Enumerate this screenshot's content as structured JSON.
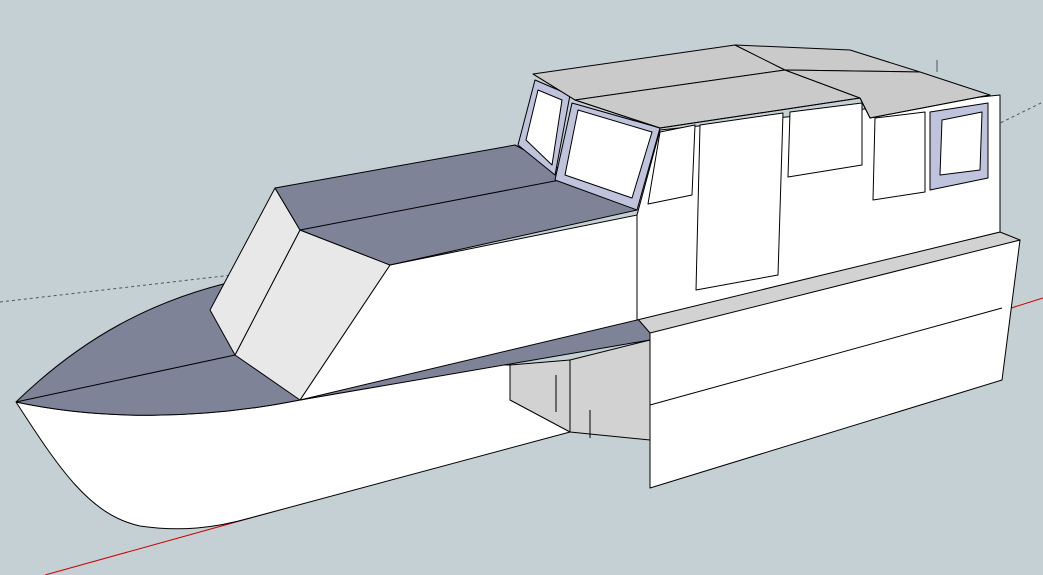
{
  "viewport": {
    "background_color": "#c4d0d3",
    "face_colors": {
      "front": "#ffffff",
      "back": "#7f8398",
      "shaded": "#d2d2d2",
      "glass": "#bfc3dc",
      "roof": "#cacaca"
    },
    "axis_colors": {
      "red_axis": "#cc0000",
      "green_axis": "#3a8a3a",
      "guide": "#555555"
    },
    "model": "boat"
  }
}
